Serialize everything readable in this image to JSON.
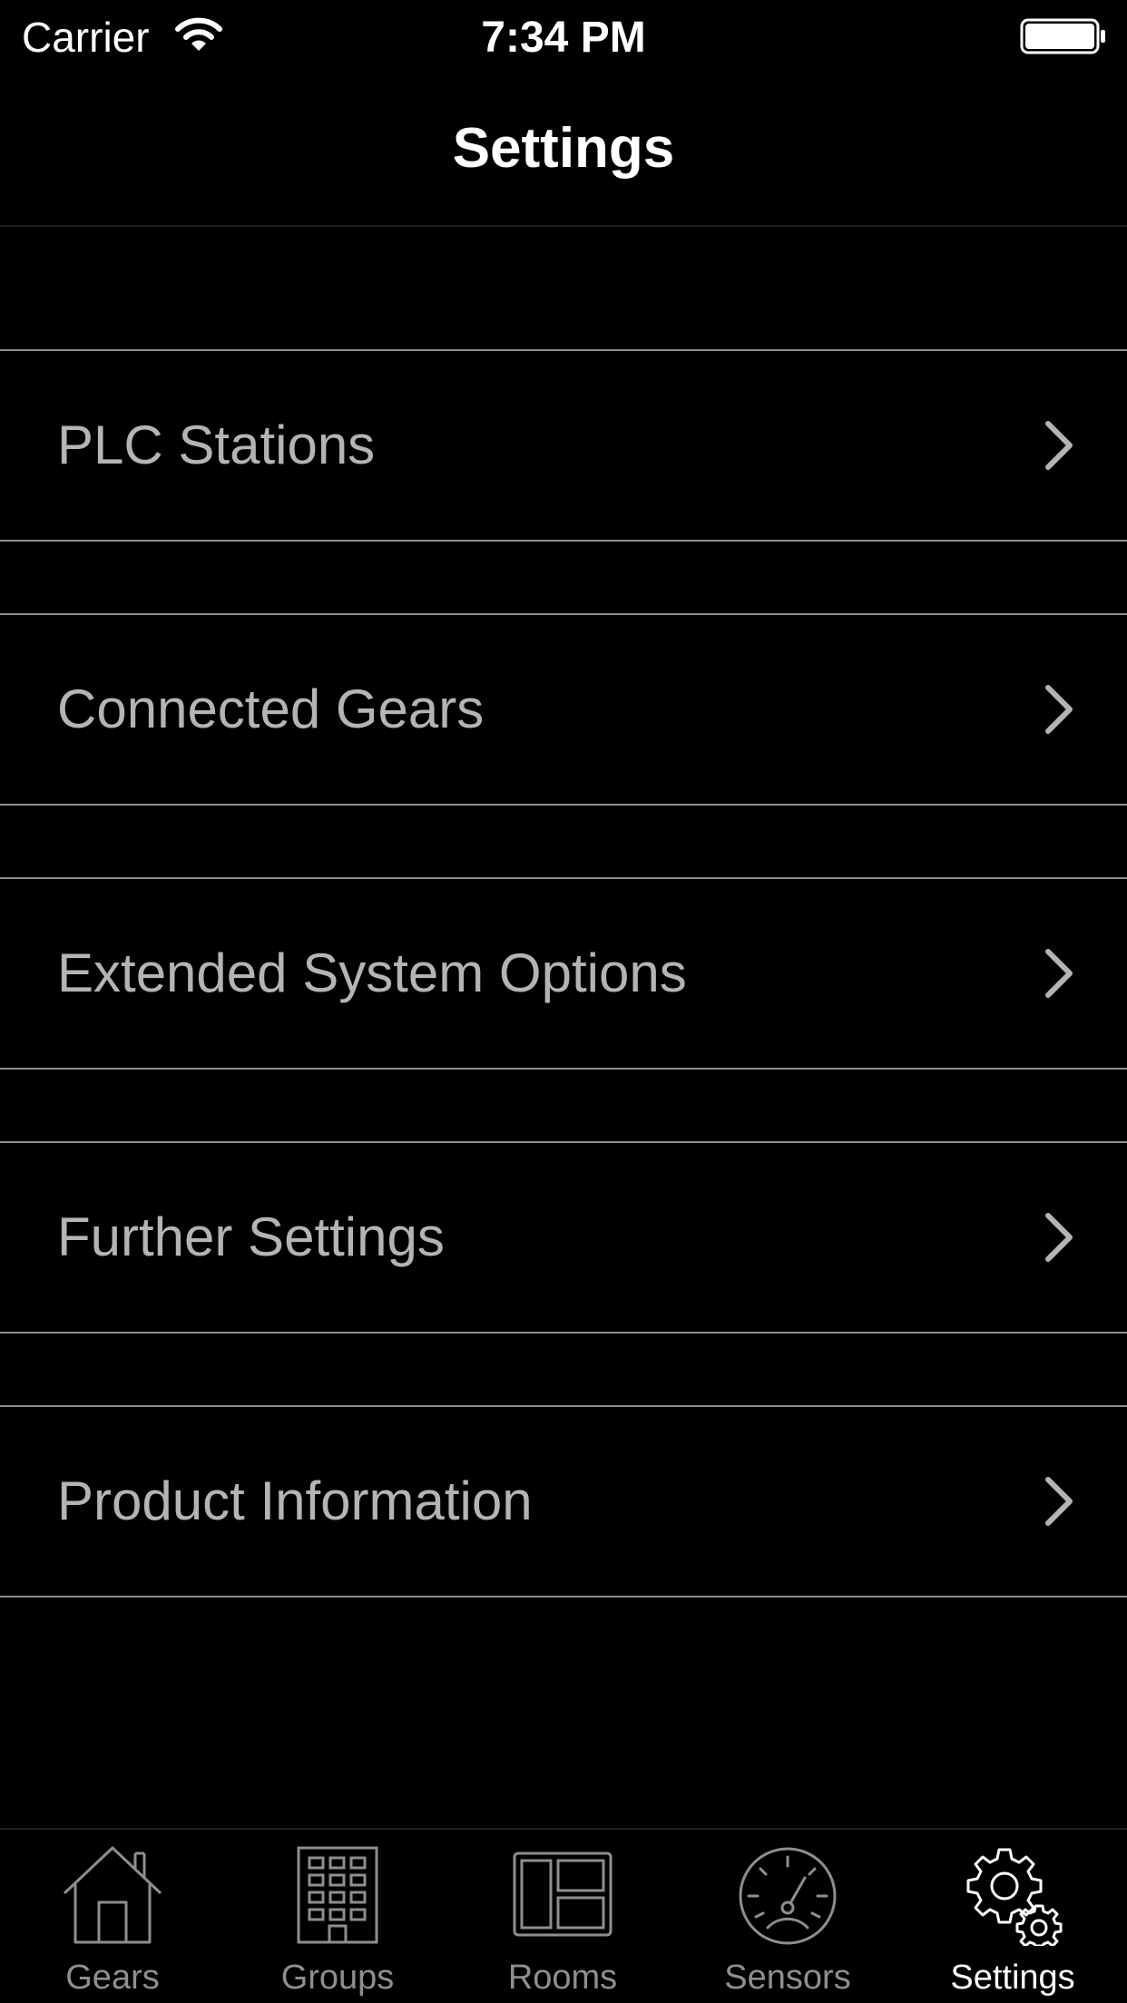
{
  "status_bar": {
    "carrier": "Carrier",
    "time": "7:34 PM",
    "icons": [
      "wifi-icon",
      "battery-icon"
    ]
  },
  "nav": {
    "title": "Settings"
  },
  "menu": {
    "items": [
      {
        "label": "PLC Stations",
        "icon": "chevron-right-icon"
      },
      {
        "label": "Connected Gears",
        "icon": "chevron-right-icon"
      },
      {
        "label": "Extended System Options",
        "icon": "chevron-right-icon"
      },
      {
        "label": "Further Settings",
        "icon": "chevron-right-icon"
      },
      {
        "label": "Product Information",
        "icon": "chevron-right-icon"
      }
    ]
  },
  "tab_bar": {
    "active": "Settings",
    "tabs": [
      {
        "label": "Gears",
        "icon": "house-icon"
      },
      {
        "label": "Groups",
        "icon": "building-icon"
      },
      {
        "label": "Rooms",
        "icon": "rooms-layout-icon"
      },
      {
        "label": "Sensors",
        "icon": "gauge-icon"
      },
      {
        "label": "Settings",
        "icon": "gears-icon"
      }
    ]
  },
  "colors": {
    "background": "#000000",
    "separator": "#8e8e8e",
    "row_text": "#b4b4b4",
    "tab_inactive": "#8e8e8e",
    "tab_active": "#ffffff"
  }
}
